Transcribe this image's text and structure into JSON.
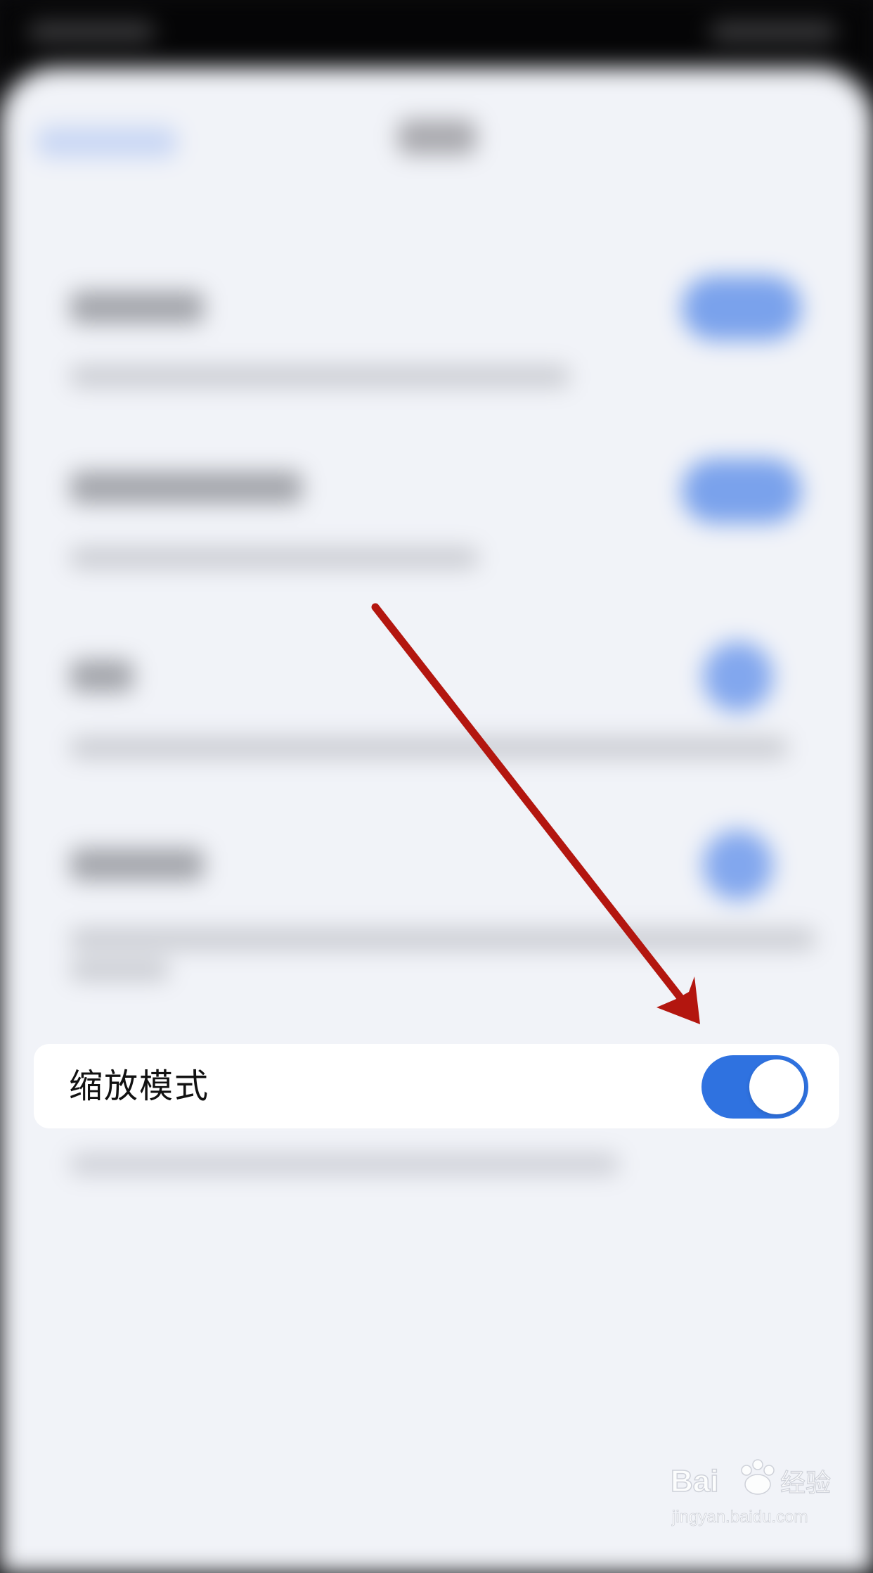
{
  "focus_item": {
    "label": "缩放模式",
    "enabled": true,
    "accent_color": "#2f72e0"
  },
  "annotation": {
    "type": "arrow",
    "color": "#b3160f"
  },
  "colors": {
    "sheet_background": "#f1f3f8",
    "card_background": "#ffffff",
    "toggle_on": "#2f72e0"
  },
  "watermark": {
    "brand": "Bai du 经验",
    "url": "jingyan.baidu.com"
  }
}
